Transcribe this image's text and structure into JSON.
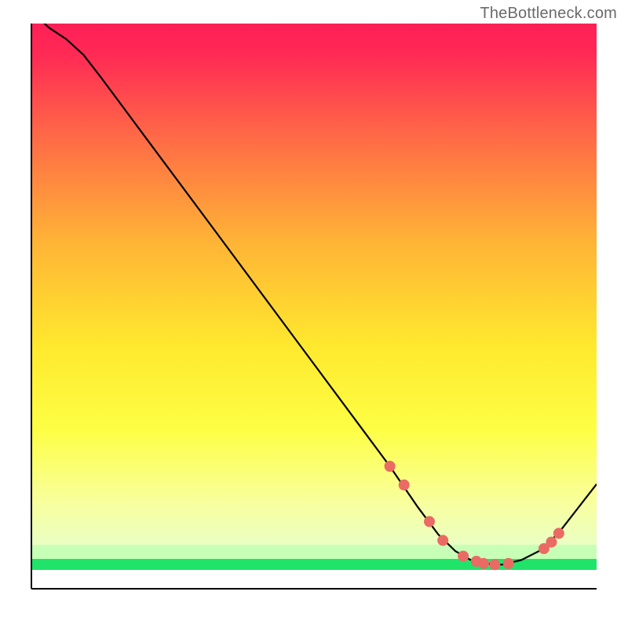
{
  "watermark": "TheBottleneck.com",
  "plot": {
    "axis_stroke": "#000000",
    "curve_stroke": "#000000",
    "marker_fill": "#ea6a64",
    "bg_top": "#ff1f56",
    "bg_mid1": "#ff8f3e",
    "bg_mid2": "#fff32b",
    "bg_mid3": "#f7ffab",
    "bg_band_pale": "#d7ffc0",
    "bg_band_green": "#20e36a",
    "bg_bottom_white": "#ffffff"
  },
  "chart_data": {
    "type": "line",
    "title": "",
    "xlabel": "",
    "ylabel": "",
    "xlim": [
      0,
      100
    ],
    "ylim": [
      0,
      100
    ],
    "note": "Axes are unlabeled in the image; x is plotted left→right, y is plotted with 0 at bottom. Values are read off the figure's 90×90 inner drawing area mapped to 0–100.",
    "series": [
      {
        "name": "curve",
        "x": [
          0.0,
          3.1,
          6.1,
          9.2,
          12.3,
          21.5,
          30.7,
          43.0,
          58.3,
          63.4,
          68.3,
          72.0,
          75.0,
          77.6,
          80.0,
          83.3,
          86.7,
          90.7,
          93.9,
          96.9,
          100.0
        ],
        "y": [
          102.3,
          99.3,
          97.3,
          94.5,
          90.5,
          78.2,
          65.8,
          49.2,
          28.5,
          21.7,
          14.5,
          9.6,
          6.7,
          5.2,
          4.5,
          4.3,
          5.1,
          7.1,
          10.7,
          14.6,
          18.5
        ]
      }
    ],
    "markers": {
      "name": "dots",
      "x": [
        63.4,
        65.9,
        70.4,
        72.8,
        76.4,
        78.7,
        80.0,
        82.0,
        84.4,
        90.7,
        92.0,
        93.3
      ],
      "y": [
        21.7,
        18.4,
        11.9,
        8.6,
        5.8,
        4.9,
        4.5,
        4.3,
        4.5,
        7.1,
        8.2,
        9.8
      ]
    }
  }
}
